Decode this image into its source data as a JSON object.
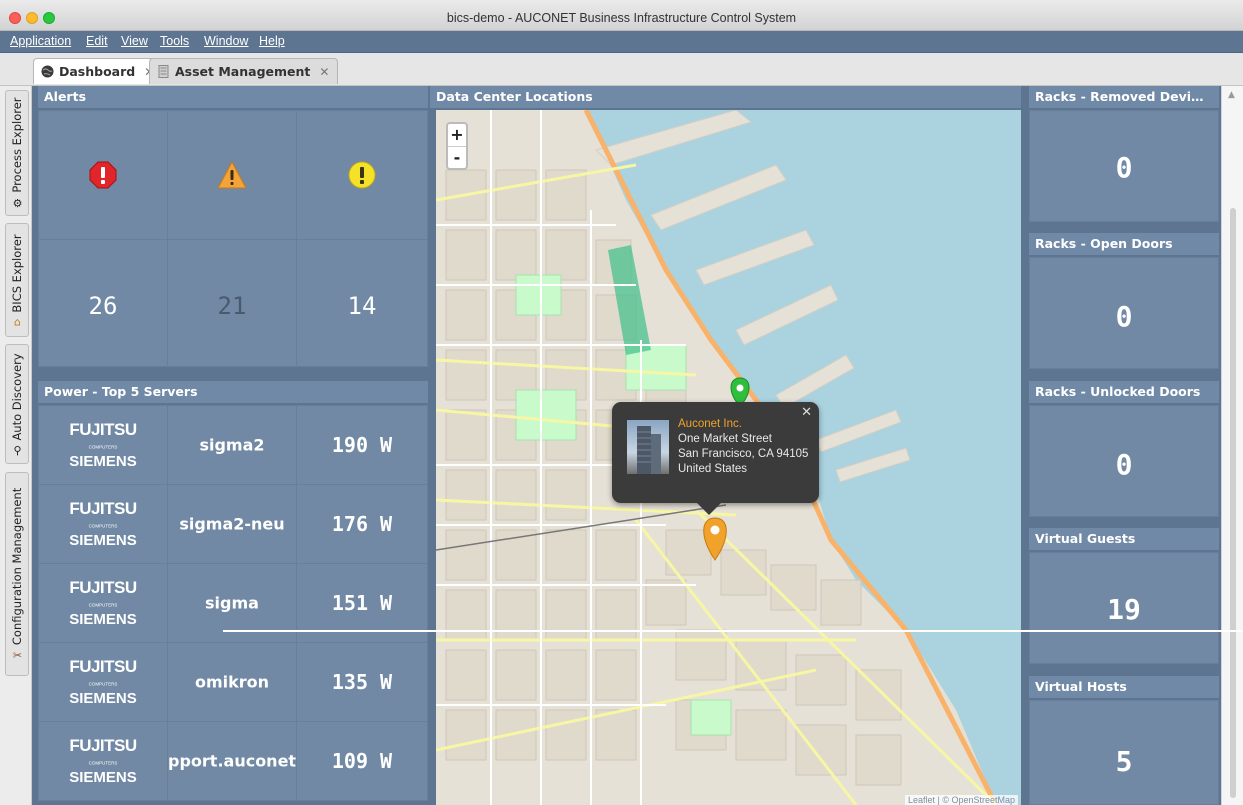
{
  "window": {
    "title": "bics-demo - AUCONET Business Infrastructure Control System"
  },
  "menu": [
    "Application",
    "Edit",
    "View",
    "Tools",
    "Window",
    "Help"
  ],
  "tabs": [
    {
      "label": "Dashboard",
      "active": true,
      "icon": "globe-icon"
    },
    {
      "label": "Asset Management",
      "active": false,
      "icon": "rack-icon"
    }
  ],
  "side_tabs": [
    {
      "label": "Process Explorer",
      "icon": "gear-icon"
    },
    {
      "label": "BICS Explorer",
      "icon": "home-icon"
    },
    {
      "label": "Auto Discovery",
      "icon": "magnifier-icon"
    },
    {
      "label": "Configuration Management",
      "icon": "tools-icon"
    }
  ],
  "alerts": {
    "title": "Alerts",
    "levels": [
      {
        "icon": "critical-alert-icon",
        "count": "26",
        "color": "#e0262a"
      },
      {
        "icon": "warning-alert-icon",
        "count": "21",
        "color": "#f2a43a"
      },
      {
        "icon": "info-alert-icon",
        "count": "14",
        "color": "#f5e12a"
      }
    ]
  },
  "power": {
    "title": "Power - Top 5 Servers",
    "brand": {
      "top": "FUJITSU",
      "small": "COMPUTERS",
      "bottom": "SIEMENS"
    },
    "servers": [
      {
        "name": "sigma2",
        "watts": "190 W"
      },
      {
        "name": "sigma2-neu",
        "watts": "176 W"
      },
      {
        "name": "sigma",
        "watts": "151 W"
      },
      {
        "name": "omikron",
        "watts": "135 W"
      },
      {
        "name": "pport.auconet.cc",
        "watts": "109 W"
      }
    ]
  },
  "map": {
    "title": "Data Center Locations",
    "zoom_in": "+",
    "zoom_out": "-",
    "popup": {
      "company": "Auconet Inc.",
      "street": "One Market Street",
      "city": "San Francisco, CA 94105",
      "country": "United States",
      "close": "✕"
    },
    "attribution": "Leaflet | © OpenStreetMap"
  },
  "metrics": [
    {
      "title": "Racks - Removed Devi…",
      "value": "0"
    },
    {
      "title": "Racks - Open Doors",
      "value": "0"
    },
    {
      "title": "Racks - Unlocked Doors",
      "value": "0"
    },
    {
      "title": "Virtual Guests",
      "value": "19"
    },
    {
      "title": "Virtual Hosts",
      "value": "5"
    }
  ],
  "colors": {
    "dashboard_bg": "#5e7591",
    "tile_bg": "#7189a4",
    "popup_company": "#f0a22b",
    "marker_green": "#2fbf3c",
    "marker_orange": "#f0a22b"
  }
}
